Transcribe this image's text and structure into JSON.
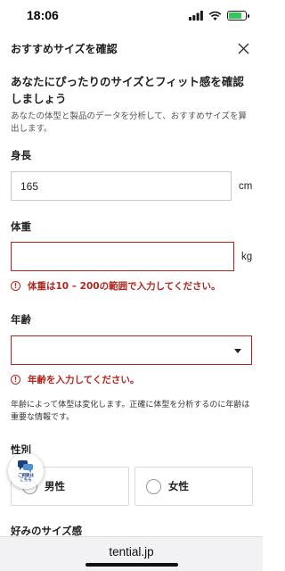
{
  "status_bar": {
    "time": "18:06",
    "battery_level": 0.75,
    "battery_color": "#35c759"
  },
  "header": {
    "title": "おすすめサイズを確認"
  },
  "intro": {
    "title": "あなたにぴったりのサイズとフィット感を確認しましょう",
    "description": "あなたの体型と製品のデータを分析して、おすすめサイズを算出します。"
  },
  "height": {
    "label": "身長",
    "value": "165",
    "unit": "cm"
  },
  "weight": {
    "label": "体重",
    "value": "",
    "unit": "kg",
    "error": "体重は10 – 200の範囲で入力してください。"
  },
  "age": {
    "label": "年齢",
    "selected": "",
    "error": "年齢を入力してください。"
  },
  "age_note": "年齢によって体型は変化します。正確に体型を分析するのに年齢は重要な情報です。",
  "gender": {
    "label": "性別",
    "options": [
      "男性",
      "女性"
    ]
  },
  "fit": {
    "label": "好みのサイズ感"
  },
  "chat": {
    "label": "ご相談は\nこちら"
  },
  "browser": {
    "url": "tential.jp"
  },
  "colors": {
    "error": "#b3261e",
    "accent": "#1d3f7a"
  }
}
